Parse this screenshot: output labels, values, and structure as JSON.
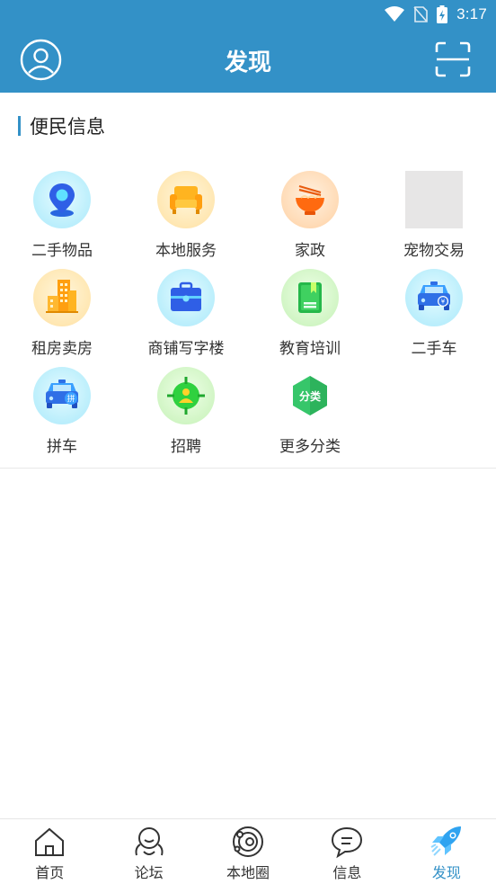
{
  "status_bar": {
    "time": "3:17"
  },
  "header": {
    "title": "发现"
  },
  "section": {
    "title": "便民信息"
  },
  "categories": [
    {
      "label": "二手物品",
      "icon": "location-pin-icon"
    },
    {
      "label": "本地服务",
      "icon": "sofa-icon"
    },
    {
      "label": "家政",
      "icon": "noodle-bowl-icon"
    },
    {
      "label": "宠物交易",
      "icon": "image-placeholder-icon"
    },
    {
      "label": "租房卖房",
      "icon": "building-icon"
    },
    {
      "label": "商铺写字楼",
      "icon": "briefcase-icon"
    },
    {
      "label": "教育培训",
      "icon": "book-icon"
    },
    {
      "label": "二手车",
      "icon": "car-icon"
    },
    {
      "label": "拼车",
      "icon": "carpool-car-icon"
    },
    {
      "label": "招聘",
      "icon": "recruit-target-icon"
    },
    {
      "label": "更多分类",
      "icon": "more-category-icon"
    }
  ],
  "more_badge": "分类",
  "carpool_badge": "拼",
  "tabs": [
    {
      "label": "首页",
      "icon": "home-icon",
      "active": false
    },
    {
      "label": "论坛",
      "icon": "forum-icon",
      "active": false
    },
    {
      "label": "本地圈",
      "icon": "local-circle-icon",
      "active": false
    },
    {
      "label": "信息",
      "icon": "message-icon",
      "active": false
    },
    {
      "label": "发现",
      "icon": "rocket-icon",
      "active": true
    }
  ],
  "colors": {
    "primary": "#3391c7",
    "background": "#ffffff"
  }
}
